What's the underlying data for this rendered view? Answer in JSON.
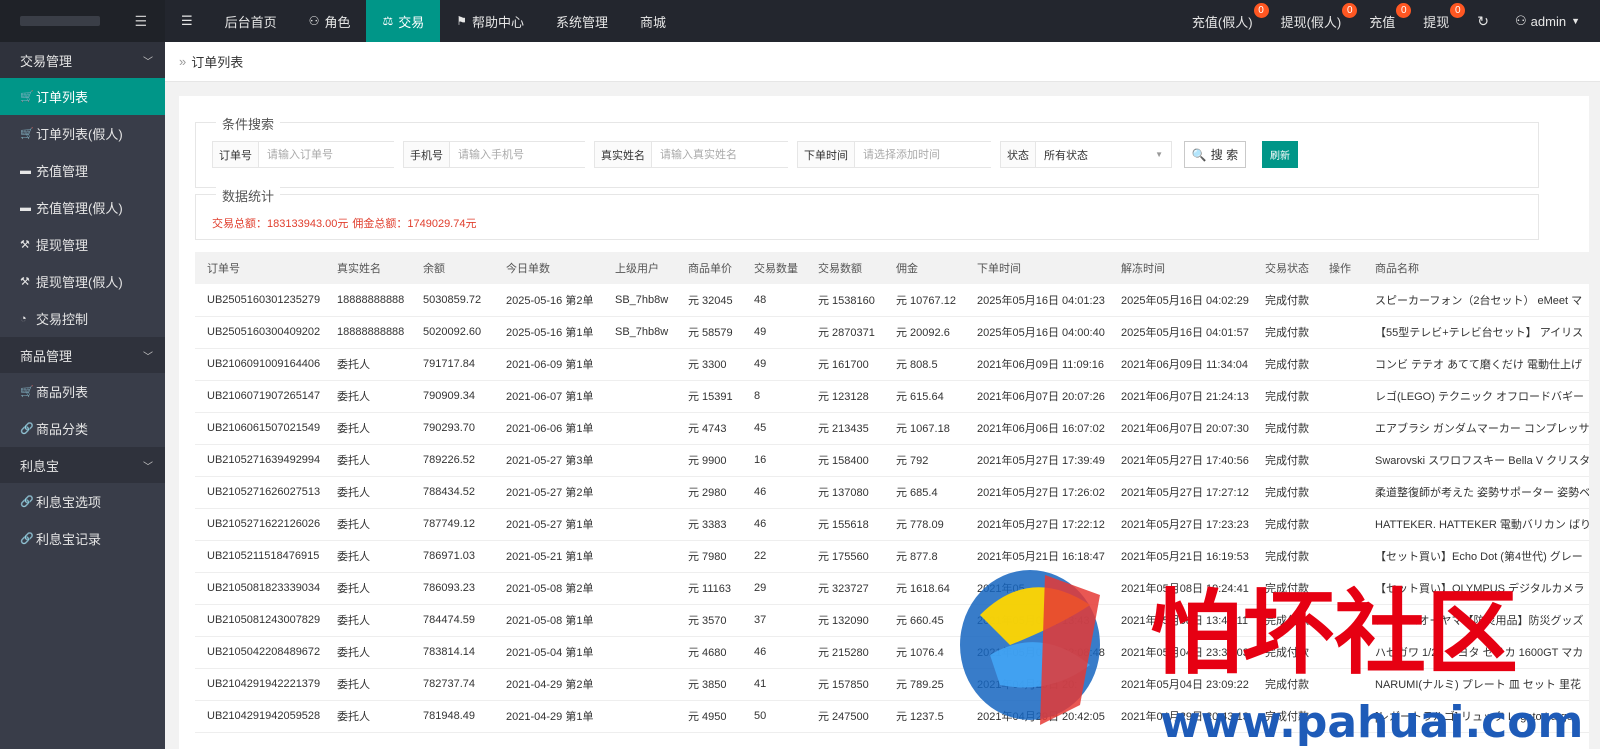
{
  "topbar": {
    "nav": [
      {
        "label": "后台首页",
        "icon": ""
      },
      {
        "label": "角色",
        "icon": "user-icon"
      },
      {
        "label": "交易",
        "icon": "scale-icon"
      },
      {
        "label": "帮助中心",
        "icon": "flag-icon"
      },
      {
        "label": "系统管理",
        "icon": ""
      },
      {
        "label": "商城",
        "icon": ""
      }
    ],
    "right": [
      {
        "label": "充值(假人)",
        "badge": "0"
      },
      {
        "label": "提现(假人)",
        "badge": "0"
      },
      {
        "label": "充值",
        "badge": "0"
      },
      {
        "label": "提现",
        "badge": "0"
      }
    ],
    "user": "admin"
  },
  "sidebar": {
    "groups": [
      {
        "label": "交易管理",
        "items": [
          {
            "label": "订单列表",
            "icon": "cart-icon"
          },
          {
            "label": "订单列表(假人)",
            "icon": "cart-icon"
          },
          {
            "label": "充值管理",
            "icon": "comment-icon"
          },
          {
            "label": "充值管理(假人)",
            "icon": "comment-icon"
          },
          {
            "label": "提现管理",
            "icon": "gavel-icon"
          },
          {
            "label": "提现管理(假人)",
            "icon": "gavel-icon"
          },
          {
            "label": "交易控制",
            "icon": "gauge-icon"
          }
        ]
      },
      {
        "label": "商品管理",
        "items": [
          {
            "label": "商品列表",
            "icon": "cart-icon"
          },
          {
            "label": "商品分类",
            "icon": "link-icon"
          }
        ]
      },
      {
        "label": "利息宝",
        "items": [
          {
            "label": "利息宝选项",
            "icon": "link-icon"
          },
          {
            "label": "利息宝记录",
            "icon": "link-icon"
          }
        ]
      }
    ]
  },
  "breadcrumb": "订单列表",
  "search": {
    "legend": "条件搜索",
    "order_label": "订单号",
    "order_placeholder": "请输入订单号",
    "phone_label": "手机号",
    "phone_placeholder": "请输入手机号",
    "name_label": "真实姓名",
    "name_placeholder": "请输入真实姓名",
    "time_label": "下单时间",
    "time_placeholder": "请选择添加时间",
    "status_label": "状态",
    "status_value": "所有状态",
    "search_btn": "搜 索",
    "refresh_btn": "刷新"
  },
  "stats": {
    "legend": "数据统计",
    "total_trade": "交易总额：183133943.00元",
    "total_commission": "佣金总额：1749029.74元"
  },
  "table": {
    "headers": [
      "订单号",
      "真实姓名",
      "余额",
      "今日单数",
      "上级用户",
      "商品单价",
      "交易数量",
      "交易数额",
      "佣金",
      "下单时间",
      "解冻时间",
      "交易状态",
      "操作",
      "商品名称"
    ],
    "rows": [
      [
        "UB2505160301235279",
        "18888888888",
        "5030859.72",
        "2025-05-16 第2单",
        "SB_7hb8w",
        "元 32045",
        "48",
        "元 1538160",
        "元 10767.12",
        "2025年05月16日 04:01:23",
        "2025年05月16日 04:02:29",
        "完成付款",
        "",
        "スピーカーフォン（2台セット） eMeet マ"
      ],
      [
        "UB2505160300409202",
        "18888888888",
        "5020092.60",
        "2025-05-16 第1单",
        "SB_7hb8w",
        "元 58579",
        "49",
        "元 2870371",
        "元 20092.6",
        "2025年05月16日 04:00:40",
        "2025年05月16日 04:01:57",
        "完成付款",
        "",
        "【55型テレビ+テレビ台セット】 アイリス"
      ],
      [
        "UB2106091009164406",
        "委托人",
        "791717.84",
        "2021-06-09 第1单",
        "",
        "元 3300",
        "49",
        "元 161700",
        "元 808.5",
        "2021年06月09日 11:09:16",
        "2021年06月09日 11:34:04",
        "完成付款",
        "",
        "コンビ テテオ あてて磨くだけ 電動仕上げ"
      ],
      [
        "UB2106071907265147",
        "委托人",
        "790909.34",
        "2021-06-07 第1单",
        "",
        "元 15391",
        "8",
        "元 123128",
        "元 615.64",
        "2021年06月07日 20:07:26",
        "2021年06月07日 21:24:13",
        "完成付款",
        "",
        "レゴ(LEGO) テクニック オフロードバギー"
      ],
      [
        "UB2106061507021549",
        "委托人",
        "790293.70",
        "2021-06-06 第1单",
        "",
        "元 4743",
        "45",
        "元 213435",
        "元 1067.18",
        "2021年06月06日 16:07:02",
        "2021年06月07日 20:07:30",
        "完成付款",
        "",
        "エアブラシ ガンダムマーカー コンプレッサ"
      ],
      [
        "UB2105271639492994",
        "委托人",
        "789226.52",
        "2021-05-27 第3单",
        "",
        "元 9900",
        "16",
        "元 158400",
        "元 792",
        "2021年05月27日 17:39:49",
        "2021年05月27日 17:40:56",
        "完成付款",
        "",
        "Swarovski スワロフスキー Bella V クリスタ"
      ],
      [
        "UB2105271626027513",
        "委托人",
        "788434.52",
        "2021-05-27 第2单",
        "",
        "元 2980",
        "46",
        "元 137080",
        "元 685.4",
        "2021年05月27日 17:26:02",
        "2021年05月27日 17:27:12",
        "完成付款",
        "",
        "柔道整復師が考えた 姿勢サポーター 姿勢ベ"
      ],
      [
        "UB2105271622126026",
        "委托人",
        "787749.12",
        "2021-05-27 第1单",
        "",
        "元 3383",
        "46",
        "元 155618",
        "元 778.09",
        "2021年05月27日 17:22:12",
        "2021年05月27日 17:23:23",
        "完成付款",
        "",
        "HATTEKER. HATTEKER 電動バリカン ばり"
      ],
      [
        "UB2105211518476915",
        "委托人",
        "786971.03",
        "2021-05-21 第1单",
        "",
        "元 7980",
        "22",
        "元 175560",
        "元 877.8",
        "2021年05月21日 16:18:47",
        "2021年05月21日 16:19:53",
        "完成付款",
        "",
        "【セット買い】Echo Dot (第4世代) グレー"
      ],
      [
        "UB2105081823339034",
        "委托人",
        "786093.23",
        "2021-05-08 第2单",
        "",
        "元 11163",
        "29",
        "元 323727",
        "元 1618.64",
        "2021年05",
        "2021年05月08日 19:24:41",
        "完成付款",
        "",
        "【セット買い】OLYMPUS デジタルカメラ"
      ],
      [
        "UB2105081243007829",
        "委托人",
        "784474.59",
        "2021-05-08 第1单",
        "",
        "元 3570",
        "37",
        "元 132090",
        "元 660.45",
        "2021年05月08日 13:43",
        "2021年05月08日 13:44:11",
        "完成付款",
        "",
        "アイリスオーヤマ【防災用品】防災グッズ"
      ],
      [
        "UB2105042208489672",
        "委托人",
        "783814.14",
        "2021-05-04 第1单",
        "",
        "元 4680",
        "46",
        "元 215280",
        "元 1076.4",
        "2021年05月04日 22:08:48",
        "2021年05月04日 23:33:03",
        "完成付款",
        "",
        "ハセガワ 1/24 トヨタ セリカ 1600GT マカ"
      ],
      [
        "UB2104291942221379",
        "委托人",
        "782737.74",
        "2021-04-29 第2单",
        "",
        "元 3850",
        "41",
        "元 157850",
        "元 789.25",
        "2021年04月29日 20:",
        "2021年05月04日 23:09:22",
        "完成付款",
        "",
        "NARUMI(ナルミ) プレート 皿 セット 里花"
      ],
      [
        "UB2104291942059528",
        "委托人",
        "781948.49",
        "2021-04-29 第1单",
        "",
        "元 4950",
        "50",
        "元 247500",
        "元 1237.5",
        "2021年04月29日 20:42:05",
        "2021年04月29日 20:43:13",
        "完成付款",
        "",
        "[レガートラルゴ] リュック Legato Largo"
      ]
    ]
  },
  "watermark": {
    "title": "怕坏社区",
    "url": "www.pahuai.com"
  }
}
